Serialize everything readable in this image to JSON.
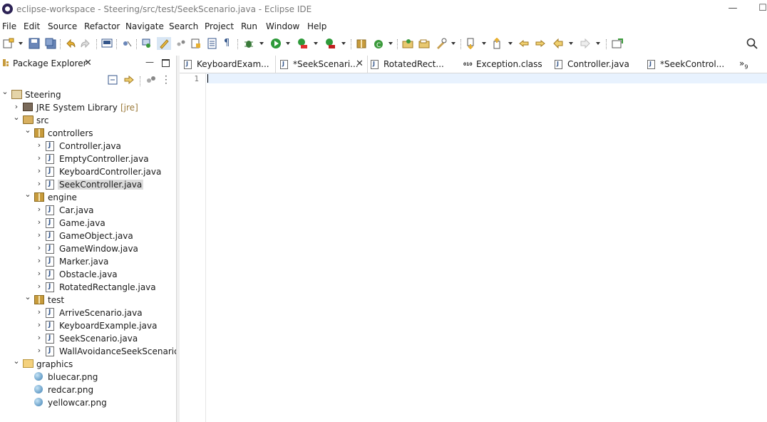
{
  "window": {
    "title": "eclipse-workspace - Steering/src/test/SeekScenario.java - Eclipse IDE",
    "minimize_glyph": "—",
    "maximize_glyph": "☐"
  },
  "menu": [
    "File",
    "Edit",
    "Source",
    "Refactor",
    "Navigate",
    "Search",
    "Project",
    "Run",
    "Window",
    "Help"
  ],
  "package_explorer": {
    "title": "Package Explorer",
    "close_glyph": "✕",
    "minimize_glyph": "—",
    "tree": [
      {
        "label": "Steering",
        "type": "project",
        "depth": 0,
        "expanded": true
      },
      {
        "label": "JRE System Library",
        "decoration": "[jre]",
        "type": "library",
        "depth": 1,
        "expanded": false
      },
      {
        "label": "src",
        "type": "source-folder",
        "depth": 1,
        "expanded": true
      },
      {
        "label": "controllers",
        "type": "package",
        "depth": 2,
        "expanded": true
      },
      {
        "label": "Controller.java",
        "type": "java",
        "depth": 3
      },
      {
        "label": "EmptyController.java",
        "type": "java",
        "depth": 3
      },
      {
        "label": "KeyboardController.java",
        "type": "java",
        "depth": 3
      },
      {
        "label": "SeekController.java",
        "type": "java",
        "depth": 3,
        "selected": true
      },
      {
        "label": "engine",
        "type": "package",
        "depth": 2,
        "expanded": true
      },
      {
        "label": "Car.java",
        "type": "java",
        "depth": 3
      },
      {
        "label": "Game.java",
        "type": "java",
        "depth": 3
      },
      {
        "label": "GameObject.java",
        "type": "java",
        "depth": 3
      },
      {
        "label": "GameWindow.java",
        "type": "java",
        "depth": 3
      },
      {
        "label": "Marker.java",
        "type": "java",
        "depth": 3
      },
      {
        "label": "Obstacle.java",
        "type": "java",
        "depth": 3
      },
      {
        "label": "RotatedRectangle.java",
        "type": "java",
        "depth": 3
      },
      {
        "label": "test",
        "type": "package",
        "depth": 2,
        "expanded": true
      },
      {
        "label": "ArriveScenario.java",
        "type": "java",
        "depth": 3
      },
      {
        "label": "KeyboardExample.java",
        "type": "java",
        "depth": 3
      },
      {
        "label": "SeekScenario.java",
        "type": "java",
        "depth": 3
      },
      {
        "label": "WallAvoidanceSeekScenario.jav",
        "type": "java",
        "depth": 3
      },
      {
        "label": "graphics",
        "type": "folder",
        "depth": 1,
        "expanded": true
      },
      {
        "label": "bluecar.png",
        "type": "png",
        "depth": 2
      },
      {
        "label": "redcar.png",
        "type": "png",
        "depth": 2
      },
      {
        "label": "yellowcar.png",
        "type": "png",
        "depth": 2
      }
    ]
  },
  "editor_tabs": [
    {
      "label": "KeyboardExam...",
      "kind": "java",
      "active": false
    },
    {
      "label": "*SeekScenari...",
      "kind": "java",
      "active": true,
      "close_glyph": "✕"
    },
    {
      "label": "RotatedRect...",
      "kind": "java",
      "active": false
    },
    {
      "label": "Exception.class",
      "kind": "class",
      "active": false
    },
    {
      "label": "Controller.java",
      "kind": "java",
      "active": false
    },
    {
      "label": "*SeekControl...",
      "kind": "java",
      "active": false
    }
  ],
  "editor_overflow": {
    "glyph": "»",
    "count": "9"
  },
  "editor": {
    "line_number": "1"
  }
}
